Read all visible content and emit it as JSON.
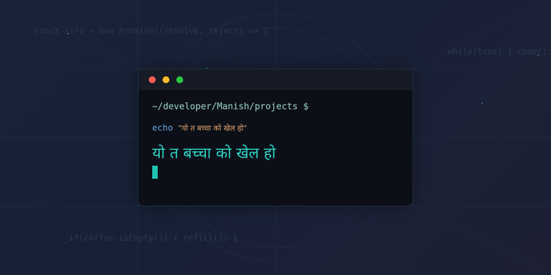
{
  "background_code": [
    "const life = new Promise((resolve, reject) => {",
    "while(true) { code(); }",
    "if(coffee.isEmpty()) { refill(); }"
  ],
  "terminal": {
    "window_controls": [
      "close",
      "minimize",
      "maximize"
    ],
    "prompt": "~/developer/Manish/projects $",
    "command": "echo",
    "argument": "\"यो त बच्चा को खेल हो\"",
    "output": "यो त बच्चा को खेल हो"
  },
  "colors": {
    "background": "#1a2238",
    "terminal_bg": "#0c0f17",
    "titlebar_bg": "#161b25",
    "prompt": "#9fd6c6",
    "command": "#6aa6e6",
    "argument": "#e0a56b",
    "output": "#2ed5c7",
    "cursor": "#20c3b0",
    "close": "#ff5f57",
    "minimize": "#febc2e",
    "maximize": "#28c840"
  }
}
